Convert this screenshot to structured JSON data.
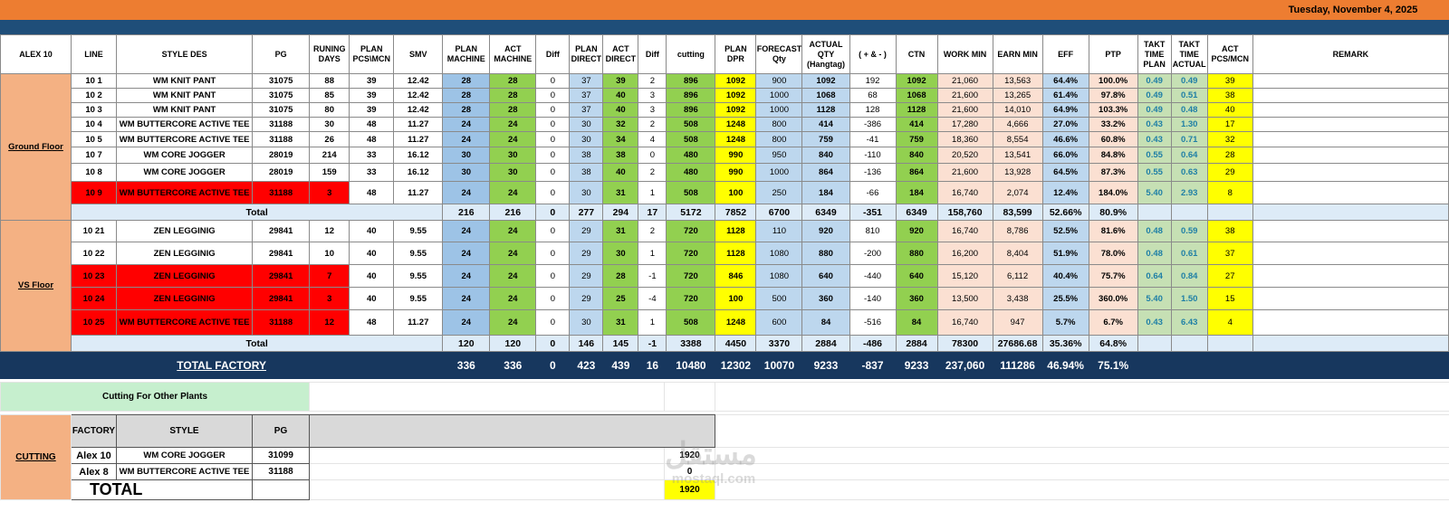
{
  "header": {
    "date": "Tuesday, November 4, 2025"
  },
  "columns": {
    "factory": "ALEX 10",
    "line": "LINE",
    "style": "STYLE DES",
    "pg": "PG",
    "running_days": "RUNING DAYS",
    "plan_pcs": "PLAN PCS\\MCN",
    "smv": "SMV",
    "plan_machine": "PLAN MACHINE",
    "act_machine": "ACT MACHINE",
    "diff1": "Diff",
    "plan_direct": "PLAN DIRECT",
    "act_direct": "ACT DIRECT",
    "diff2": "Diff",
    "cutting": "cutting",
    "plan_dpr": "PLAN DPR",
    "forecast_qty": "FORECAST Qty",
    "actual_qty": "ACTUAL QTY",
    "actual_qty_sub": "(Hangtag)",
    "plus_minus": "( + & - )",
    "ctn": "CTN",
    "work_min": "WORK MIN",
    "earn_min": "EARN MIN",
    "eff": "EFF",
    "ptp": "PTP",
    "takt_plan": "TAKT TIME PLAN",
    "takt_actual": "TAKT TIME ACTUAL",
    "act_pcs": "ACT PCS/MCN",
    "remark": "REMARK"
  },
  "ground_floor": {
    "label": "Ground Floor",
    "rows": [
      {
        "line": "10  1",
        "style": "WM KNIT PANT",
        "pg": "31075",
        "days": "88",
        "plan_pcs": "39",
        "smv": "12.42",
        "plan_machine": "28",
        "act_machine": "28",
        "diff1": "0",
        "plan_direct": "37",
        "act_direct": "39",
        "diff2": "2",
        "cutting": "896",
        "plan_dpr": "1092",
        "forecast": "900",
        "actual_qty": "1092",
        "pm": "192",
        "ctn": "1092",
        "work_min": "21,060",
        "earn_min": "13,563",
        "eff": "64.4%",
        "ptp": "100.0%",
        "takt_plan": "0.49",
        "takt_actual": "0.49",
        "act_pcs": "39",
        "remark": ""
      },
      {
        "line": "10  2",
        "style": "WM KNIT PANT",
        "pg": "31075",
        "days": "85",
        "plan_pcs": "39",
        "smv": "12.42",
        "plan_machine": "28",
        "act_machine": "28",
        "diff1": "0",
        "plan_direct": "37",
        "act_direct": "40",
        "diff2": "3",
        "cutting": "896",
        "plan_dpr": "1092",
        "forecast": "1000",
        "actual_qty": "1068",
        "pm": "68",
        "ctn": "1068",
        "work_min": "21,600",
        "earn_min": "13,265",
        "eff": "61.4%",
        "ptp": "97.8%",
        "takt_plan": "0.49",
        "takt_actual": "0.51",
        "act_pcs": "38",
        "remark": ""
      },
      {
        "line": "10  3",
        "style": "WM KNIT PANT",
        "pg": "31075",
        "days": "80",
        "plan_pcs": "39",
        "smv": "12.42",
        "plan_machine": "28",
        "act_machine": "28",
        "diff1": "0",
        "plan_direct": "37",
        "act_direct": "40",
        "diff2": "3",
        "cutting": "896",
        "plan_dpr": "1092",
        "forecast": "1000",
        "actual_qty": "1128",
        "pm": "128",
        "ctn": "1128",
        "work_min": "21,600",
        "earn_min": "14,010",
        "eff": "64.9%",
        "ptp": "103.3%",
        "takt_plan": "0.49",
        "takt_actual": "0.48",
        "act_pcs": "40",
        "remark": ""
      },
      {
        "line": "10  4",
        "style": "WM BUTTERCORE ACTIVE TEE",
        "pg": "31188",
        "days": "30",
        "plan_pcs": "48",
        "smv": "11.27",
        "plan_machine": "24",
        "act_machine": "24",
        "diff1": "0",
        "plan_direct": "30",
        "act_direct": "32",
        "diff2": "2",
        "cutting": "508",
        "plan_dpr": "1248",
        "forecast": "800",
        "actual_qty": "414",
        "pm": "-386",
        "ctn": "414",
        "work_min": "17,280",
        "earn_min": "4,666",
        "eff": "27.0%",
        "ptp": "33.2%",
        "takt_plan": "0.43",
        "takt_actual": "1.30",
        "act_pcs": "17",
        "remark": ""
      },
      {
        "line": "10  5",
        "style": "WM BUTTERCORE ACTIVE TEE",
        "pg": "31188",
        "days": "26",
        "plan_pcs": "48",
        "smv": "11.27",
        "plan_machine": "24",
        "act_machine": "24",
        "diff1": "0",
        "plan_direct": "30",
        "act_direct": "34",
        "diff2": "4",
        "cutting": "508",
        "plan_dpr": "1248",
        "forecast": "800",
        "actual_qty": "759",
        "pm": "-41",
        "ctn": "759",
        "work_min": "18,360",
        "earn_min": "8,554",
        "eff": "46.6%",
        "ptp": "60.8%",
        "takt_plan": "0.43",
        "takt_actual": "0.71",
        "act_pcs": "32",
        "remark": ""
      },
      {
        "line": "10  7",
        "style": "WM CORE JOGGER",
        "pg": "28019",
        "days": "214",
        "plan_pcs": "33",
        "smv": "16.12",
        "plan_machine": "30",
        "act_machine": "30",
        "diff1": "0",
        "plan_direct": "38",
        "act_direct": "38",
        "diff2": "0",
        "cutting": "480",
        "plan_dpr": "990",
        "forecast": "950",
        "actual_qty": "840",
        "pm": "-110",
        "ctn": "840",
        "work_min": "20,520",
        "earn_min": "13,541",
        "eff": "66.0%",
        "ptp": "84.8%",
        "takt_plan": "0.55",
        "takt_actual": "0.64",
        "act_pcs": "28",
        "remark": ""
      },
      {
        "line": "10  8",
        "style": "WM CORE JOGGER",
        "pg": "28019",
        "days": "159",
        "plan_pcs": "33",
        "smv": "16.12",
        "plan_machine": "30",
        "act_machine": "30",
        "diff1": "0",
        "plan_direct": "38",
        "act_direct": "40",
        "diff2": "2",
        "cutting": "480",
        "plan_dpr": "990",
        "forecast": "1000",
        "actual_qty": "864",
        "pm": "-136",
        "ctn": "864",
        "work_min": "21,600",
        "earn_min": "13,928",
        "eff": "64.5%",
        "ptp": "87.3%",
        "takt_plan": "0.55",
        "takt_actual": "0.63",
        "act_pcs": "29",
        "remark": ""
      },
      {
        "line": "10  9",
        "style": "WM BUTTERCORE ACTIVE TEE",
        "pg": "31188",
        "days": "3",
        "plan_pcs": "48",
        "smv": "11.27",
        "plan_machine": "24",
        "act_machine": "24",
        "diff1": "0",
        "plan_direct": "30",
        "act_direct": "31",
        "diff2": "1",
        "cutting": "508",
        "plan_dpr": "100",
        "forecast": "250",
        "actual_qty": "184",
        "pm": "-66",
        "ctn": "184",
        "work_min": "16,740",
        "earn_min": "2,074",
        "eff": "12.4%",
        "ptp": "184.0%",
        "takt_plan": "5.40",
        "takt_actual": "2.93",
        "act_pcs": "8",
        "remark": ""
      }
    ],
    "total": {
      "label": "Total",
      "plan_machine": "216",
      "act_machine": "216",
      "diff1": "0",
      "plan_direct": "277",
      "act_direct": "294",
      "diff2": "17",
      "cutting": "5172",
      "plan_dpr": "7852",
      "forecast": "6700",
      "actual_qty": "6349",
      "pm": "-351",
      "ctn": "6349",
      "work_min": "158,760",
      "earn_min": "83,599",
      "eff": "52.66%",
      "ptp": "80.9%"
    }
  },
  "vs_floor": {
    "label": "VS Floor",
    "rows": [
      {
        "line": "10  21",
        "style": "ZEN LEGGINIG",
        "pg": "29841",
        "days": "12",
        "plan_pcs": "40",
        "smv": "9.55",
        "plan_machine": "24",
        "act_machine": "24",
        "diff1": "0",
        "plan_direct": "29",
        "act_direct": "31",
        "diff2": "2",
        "cutting": "720",
        "plan_dpr": "1128",
        "forecast": "110",
        "actual_qty": "920",
        "pm": "810",
        "ctn": "920",
        "work_min": "16,740",
        "earn_min": "8,786",
        "eff": "52.5%",
        "ptp": "81.6%",
        "takt_plan": "0.48",
        "takt_actual": "0.59",
        "act_pcs": "38",
        "remark": ""
      },
      {
        "line": "10  22",
        "style": "ZEN LEGGINIG",
        "pg": "29841",
        "days": "10",
        "plan_pcs": "40",
        "smv": "9.55",
        "plan_machine": "24",
        "act_machine": "24",
        "diff1": "0",
        "plan_direct": "29",
        "act_direct": "30",
        "diff2": "1",
        "cutting": "720",
        "plan_dpr": "1128",
        "forecast": "1080",
        "actual_qty": "880",
        "pm": "-200",
        "ctn": "880",
        "work_min": "16,200",
        "earn_min": "8,404",
        "eff": "51.9%",
        "ptp": "78.0%",
        "takt_plan": "0.48",
        "takt_actual": "0.61",
        "act_pcs": "37",
        "remark": ""
      },
      {
        "line": "10  23",
        "style": "ZEN LEGGINIG",
        "pg": "29841",
        "days": "7",
        "plan_pcs": "40",
        "smv": "9.55",
        "plan_machine": "24",
        "act_machine": "24",
        "diff1": "0",
        "plan_direct": "29",
        "act_direct": "28",
        "diff2": "-1",
        "cutting": "720",
        "plan_dpr": "846",
        "forecast": "1080",
        "actual_qty": "640",
        "pm": "-440",
        "ctn": "640",
        "work_min": "15,120",
        "earn_min": "6,112",
        "eff": "40.4%",
        "ptp": "75.7%",
        "takt_plan": "0.64",
        "takt_actual": "0.84",
        "act_pcs": "27",
        "remark": ""
      },
      {
        "line": "10  24",
        "style": "ZEN LEGGINIG",
        "pg": "29841",
        "days": "3",
        "plan_pcs": "40",
        "smv": "9.55",
        "plan_machine": "24",
        "act_machine": "24",
        "diff1": "0",
        "plan_direct": "29",
        "act_direct": "25",
        "diff2": "-4",
        "cutting": "720",
        "plan_dpr": "100",
        "forecast": "500",
        "actual_qty": "360",
        "pm": "-140",
        "ctn": "360",
        "work_min": "13,500",
        "earn_min": "3,438",
        "eff": "25.5%",
        "ptp": "360.0%",
        "takt_plan": "5.40",
        "takt_actual": "1.50",
        "act_pcs": "15",
        "remark": ""
      },
      {
        "line": "10  25",
        "style": "WM BUTTERCORE ACTIVE TEE",
        "pg": "31188",
        "days": "12",
        "plan_pcs": "48",
        "smv": "11.27",
        "plan_machine": "24",
        "act_machine": "24",
        "diff1": "0",
        "plan_direct": "30",
        "act_direct": "31",
        "diff2": "1",
        "cutting": "508",
        "plan_dpr": "1248",
        "forecast": "600",
        "actual_qty": "84",
        "pm": "-516",
        "ctn": "84",
        "work_min": "16,740",
        "earn_min": "947",
        "eff": "5.7%",
        "ptp": "6.7%",
        "takt_plan": "0.43",
        "takt_actual": "6.43",
        "act_pcs": "4",
        "remark": ""
      }
    ],
    "total": {
      "label": "Total",
      "plan_machine": "120",
      "act_machine": "120",
      "diff1": "0",
      "plan_direct": "146",
      "act_direct": "145",
      "diff2": "-1",
      "cutting": "3388",
      "plan_dpr": "4450",
      "forecast": "3370",
      "actual_qty": "2884",
      "pm": "-486",
      "ctn": "2884",
      "work_min": "78300",
      "earn_min": "27686.68",
      "eff": "35.36%",
      "ptp": "64.8%"
    }
  },
  "total_factory": {
    "label": "TOTAL FACTORY",
    "plan_machine": "336",
    "act_machine": "336",
    "diff1": "0",
    "plan_direct": "423",
    "act_direct": "439",
    "diff2": "16",
    "cutting": "10480",
    "plan_dpr": "12302",
    "forecast": "10070",
    "actual_qty": "9233",
    "pm": "-837",
    "ctn": "9233",
    "work_min": "237,060",
    "earn_min": "111286",
    "eff": "46.94%",
    "ptp": "75.1%"
  },
  "cutting_section": {
    "title": "Cutting For Other Plants",
    "side_label": "CUTTING",
    "headers": {
      "factory": "FACTORY",
      "style": "STYLE",
      "pg": "PG"
    },
    "rows": [
      {
        "factory": "Alex 10",
        "style": "WM CORE JOGGER",
        "pg": "31099",
        "qty": "1920"
      },
      {
        "factory": "Alex 8",
        "style": "WM BUTTERCORE ACTIVE TEE",
        "pg": "31188",
        "qty": "0"
      }
    ],
    "total_label": "TOTAL",
    "total_value": "1920"
  },
  "watermark": {
    "text": "مستقل",
    "sub": "mostaql.com"
  }
}
